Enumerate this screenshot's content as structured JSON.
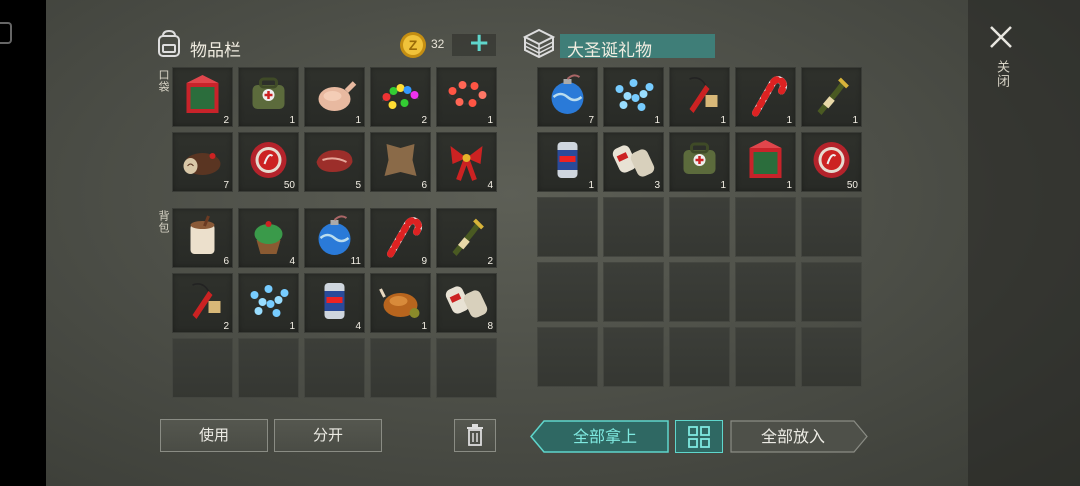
{
  "inventory": {
    "title": "物品栏",
    "coins": "32",
    "plus": "+",
    "pocket_label": "口袋",
    "backpack_label": "背包",
    "pocket_items": [
      {
        "icon": "gift-box-icon",
        "count": "2"
      },
      {
        "icon": "medkit-bag-icon",
        "count": "1"
      },
      {
        "icon": "chicken-icon",
        "count": "1"
      },
      {
        "icon": "christmas-lights-icon",
        "count": "2"
      },
      {
        "icon": "red-lights-icon",
        "count": "1"
      },
      {
        "icon": "yule-log-icon",
        "count": "7"
      },
      {
        "icon": "bottle-cap-icon",
        "count": "50"
      },
      {
        "icon": "steak-icon",
        "count": "5"
      },
      {
        "icon": "leather-hide-icon",
        "count": "6"
      },
      {
        "icon": "red-bow-icon",
        "count": "4"
      }
    ],
    "backpack_items": [
      {
        "icon": "eggnog-icon",
        "count": "6"
      },
      {
        "icon": "cupcake-icon",
        "count": "4"
      },
      {
        "icon": "ornament-ball-icon",
        "count": "11"
      },
      {
        "icon": "candy-cane-icon",
        "count": "9"
      },
      {
        "icon": "champagne-icon",
        "count": "2"
      },
      {
        "icon": "firecracker-icon",
        "count": "2"
      },
      {
        "icon": "blue-lights-icon",
        "count": "1"
      },
      {
        "icon": "beer-can-icon",
        "count": "4"
      },
      {
        "icon": "roast-turkey-icon",
        "count": "1"
      },
      {
        "icon": "bandage-icon",
        "count": "8"
      },
      {
        "icon": "",
        "count": ""
      },
      {
        "icon": "",
        "count": ""
      },
      {
        "icon": "",
        "count": ""
      },
      {
        "icon": "",
        "count": ""
      },
      {
        "icon": "",
        "count": ""
      }
    ],
    "use_label": "使用",
    "split_label": "分开"
  },
  "container": {
    "title": "大圣诞礼物",
    "items": [
      {
        "icon": "ornament-ball-icon",
        "count": "7"
      },
      {
        "icon": "blue-lights-icon",
        "count": "1"
      },
      {
        "icon": "firecracker-icon",
        "count": "1"
      },
      {
        "icon": "candy-cane-icon",
        "count": "1"
      },
      {
        "icon": "champagne-icon",
        "count": "1"
      },
      {
        "icon": "beer-can-icon",
        "count": "1"
      },
      {
        "icon": "bandage-icon",
        "count": "3"
      },
      {
        "icon": "medkit-bag-icon",
        "count": "1"
      },
      {
        "icon": "gift-box-icon",
        "count": "1"
      },
      {
        "icon": "bottle-cap-icon",
        "count": "50"
      }
    ],
    "take_all_label": "全部拿上",
    "put_all_label": "全部放入"
  },
  "close_label": "关闭",
  "colors": {
    "teal": "#5fd6cc",
    "title_bg": "#3f7e78",
    "coin": "#e8b52a"
  }
}
